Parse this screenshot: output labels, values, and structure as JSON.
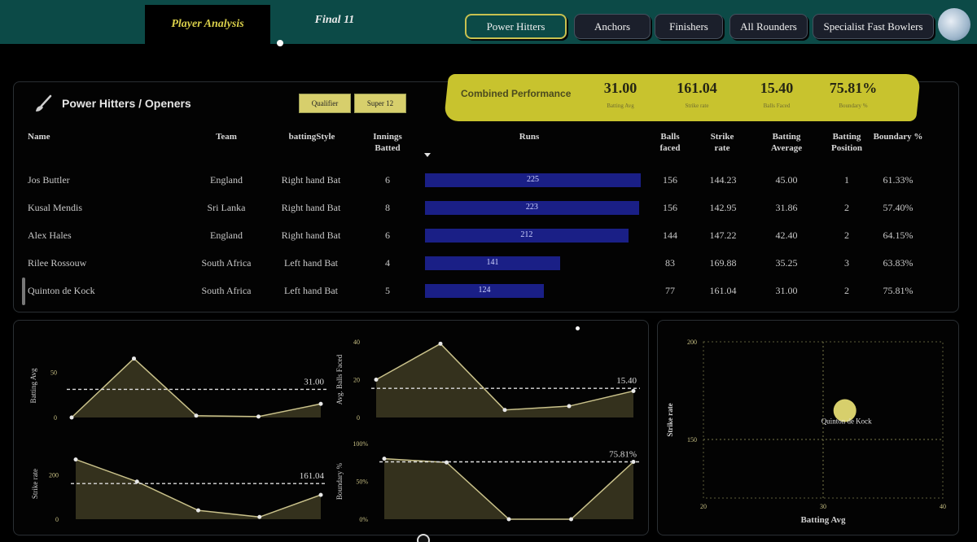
{
  "nav": {
    "tabs": [
      {
        "label": "Player Analysis",
        "active": true
      },
      {
        "label": "Final 11",
        "active": false
      }
    ],
    "categories": [
      {
        "label": "Power Hitters",
        "selected": true
      },
      {
        "label": "Anchors",
        "selected": false
      },
      {
        "label": "Finishers",
        "selected": false
      },
      {
        "label": "All Rounders",
        "selected": false
      },
      {
        "label": "Specialist Fast Bowlers",
        "selected": false
      }
    ]
  },
  "table_panel": {
    "title": "Power Hitters / Openers",
    "icon": "paintbrush-icon",
    "slicers": [
      "Qualifier",
      "Super 12"
    ],
    "combined": {
      "label": "Combined Performance",
      "kpis": [
        {
          "value": "31.00",
          "label": "Batting Avg"
        },
        {
          "value": "161.04",
          "label": "Strike rate"
        },
        {
          "value": "15.40",
          "label": "Balls Faced"
        },
        {
          "value": "75.81%",
          "label": "Boundary %"
        }
      ]
    },
    "columns": {
      "name": "Name",
      "team": "Team",
      "style": "battingStyle",
      "innings": "Innings Batted",
      "runs": "Runs",
      "balls": "Balls faced",
      "sr": "Strike rate",
      "avg": "Batting Average",
      "pos": "Batting Position",
      "boundary": "Boundary %"
    },
    "rows": [
      {
        "name": "Jos Buttler",
        "team": "England",
        "style": "Right hand Bat",
        "innings": "6",
        "runs": 225,
        "balls": "156",
        "sr": "144.23",
        "avg": "45.00",
        "pos": "1",
        "boundary": "61.33%"
      },
      {
        "name": "Kusal Mendis",
        "team": "Sri Lanka",
        "style": "Right hand Bat",
        "innings": "8",
        "runs": 223,
        "balls": "156",
        "sr": "142.95",
        "avg": "31.86",
        "pos": "2",
        "boundary": "57.40%"
      },
      {
        "name": "Alex Hales",
        "team": "England",
        "style": "Right hand Bat",
        "innings": "6",
        "runs": 212,
        "balls": "144",
        "sr": "147.22",
        "avg": "42.40",
        "pos": "2",
        "boundary": "64.15%"
      },
      {
        "name": "Rilee Rossouw",
        "team": "South Africa",
        "style": "Left hand Bat",
        "innings": "4",
        "runs": 141,
        "balls": "83",
        "sr": "169.88",
        "avg": "35.25",
        "pos": "3",
        "boundary": "63.83%"
      },
      {
        "name": "Quinton de Kock",
        "team": "South Africa",
        "style": "Left hand Bat",
        "innings": "5",
        "runs": 124,
        "balls": "77",
        "sr": "161.04",
        "avg": "31.00",
        "pos": "2",
        "boundary": "75.81%"
      }
    ],
    "runs_max": 225
  },
  "chart_data": [
    {
      "type": "area",
      "ylabel": "Batting Avg",
      "yticks": [
        "50",
        "0"
      ],
      "ylim": [
        0,
        70
      ],
      "values": [
        0,
        65,
        2,
        1,
        15
      ],
      "reference": 31.0,
      "reference_label": "31.00",
      "fill": "#3a3620",
      "line": "#c9c18a"
    },
    {
      "type": "area",
      "ylabel": "Avg. Balls Faced",
      "yticks": [
        "40",
        "20",
        "0"
      ],
      "ylim": [
        0,
        40
      ],
      "values": [
        20,
        39,
        4,
        6,
        14
      ],
      "reference": 15.4,
      "reference_label": "15.40",
      "fill": "#3a3620",
      "line": "#c9c18a"
    },
    {
      "type": "area",
      "ylabel": "Strike rate",
      "yticks": [
        "200",
        "0"
      ],
      "ylim": [
        0,
        320
      ],
      "values": [
        270,
        170,
        40,
        10,
        110
      ],
      "reference": 161.04,
      "reference_label": "161.04",
      "fill": "#3a3620",
      "line": "#c9c18a"
    },
    {
      "type": "area",
      "ylabel": "Boundary %",
      "yticks": [
        "100%",
        "50%",
        "0%"
      ],
      "ylim": [
        0,
        100
      ],
      "values": [
        80,
        75,
        0,
        0,
        75.81
      ],
      "reference": 75.81,
      "reference_label": "75.81%",
      "fill": "#3a3620",
      "line": "#c9c18a"
    },
    {
      "type": "scatter",
      "xlabel": "Batting Avg",
      "ylabel": "Strike rate",
      "xticks": [
        "20",
        "30",
        "40"
      ],
      "yticks": [
        "200",
        "150"
      ],
      "xlim": [
        20,
        40
      ],
      "ylim": [
        120,
        200
      ],
      "points": [
        {
          "x": 31.0,
          "y": 161.04,
          "label": "Quinton de Kock"
        }
      ],
      "point_color": "#d7cf6c"
    }
  ]
}
